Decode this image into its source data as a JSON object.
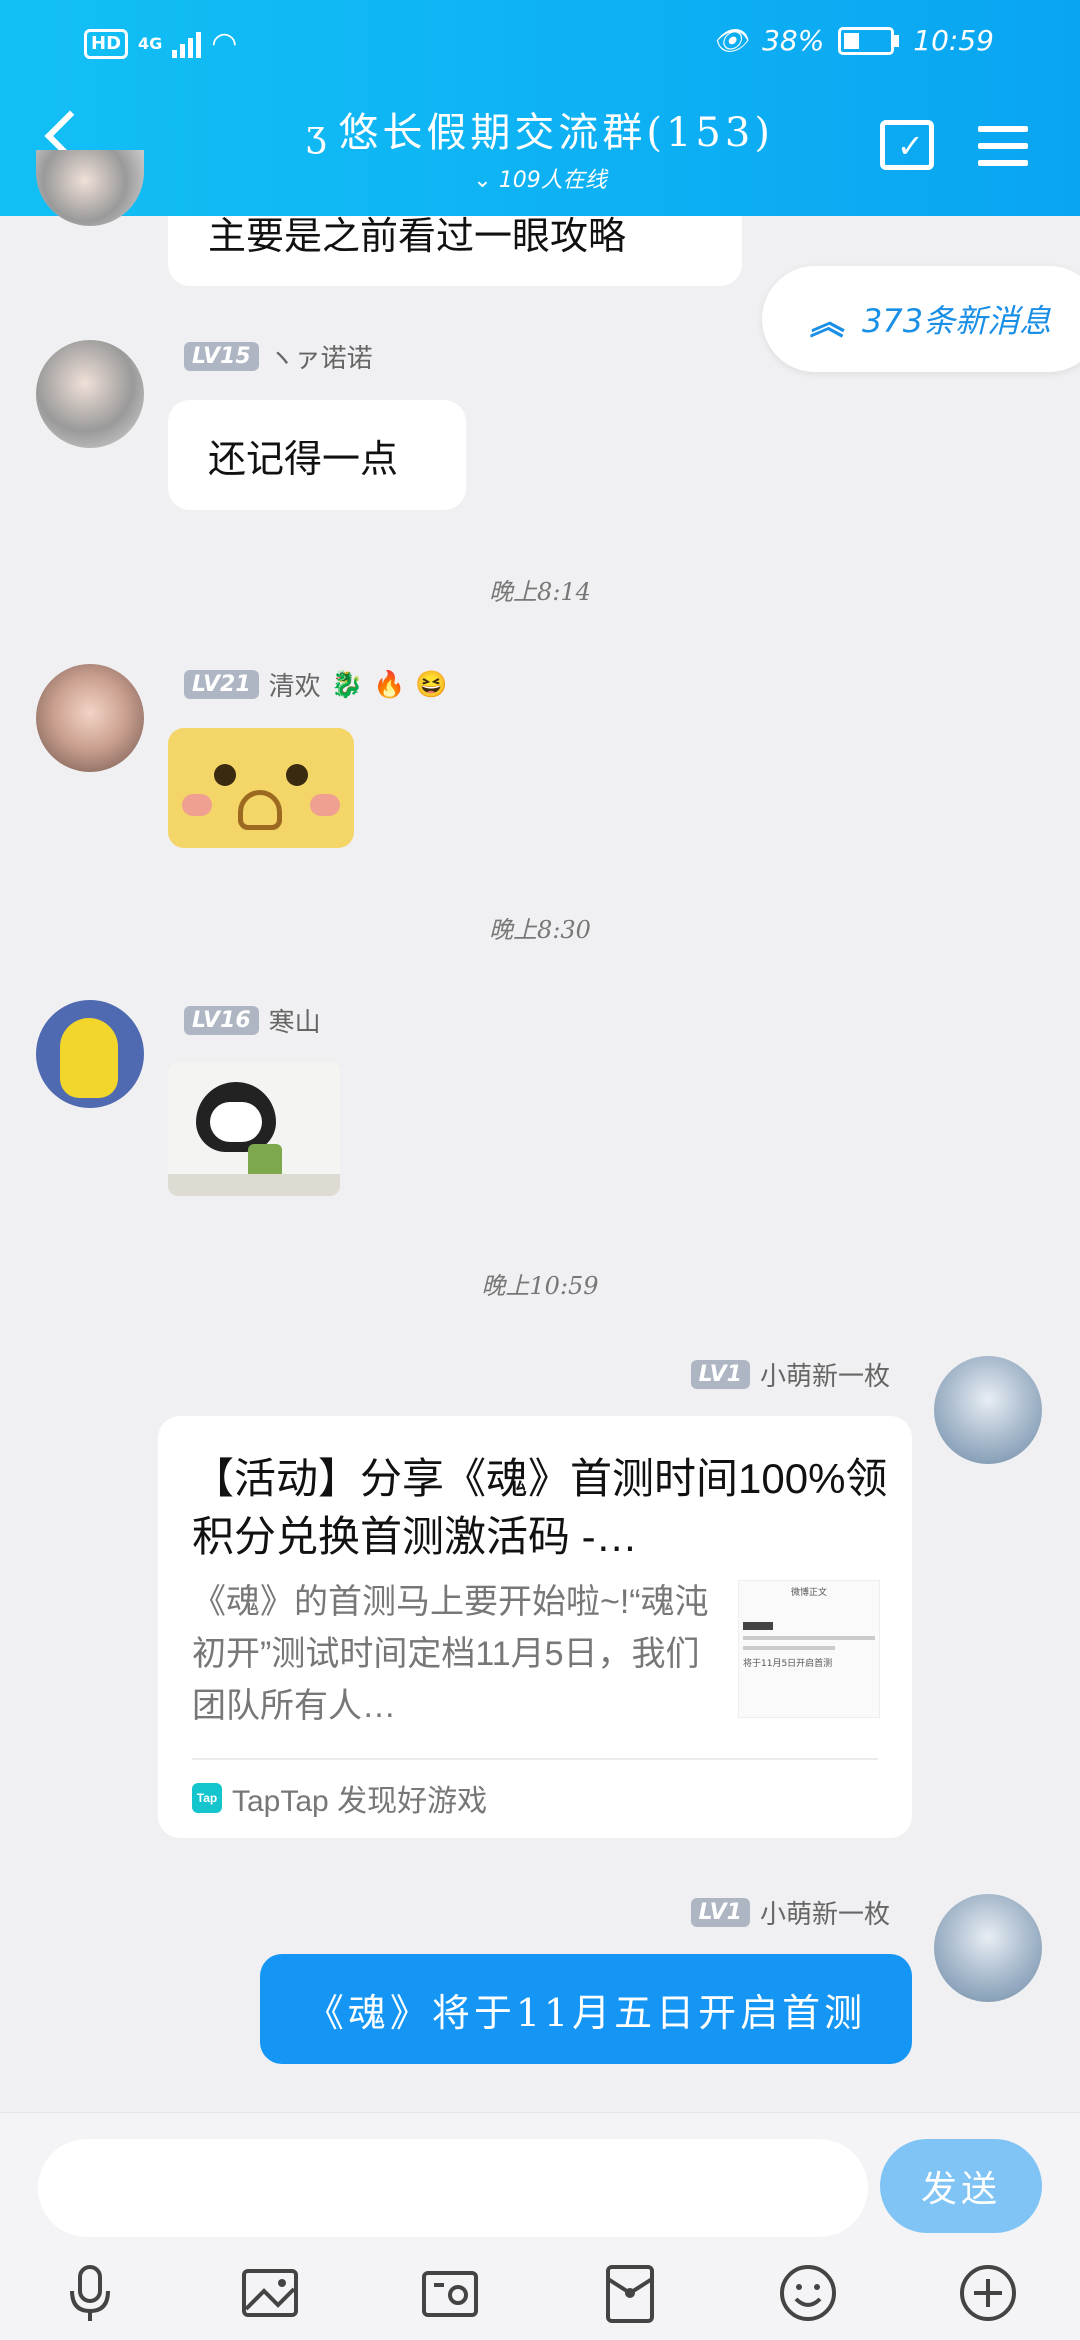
{
  "status_bar": {
    "hd": "HD",
    "network": "4G",
    "battery": "38%",
    "time": "10:59"
  },
  "header": {
    "title": "悠长假期交流群(153)",
    "online": "109人在线"
  },
  "new_messages": {
    "label": "373条新消息"
  },
  "messages": [
    {
      "type": "text",
      "text": "主要是之前看过一眼攻略"
    },
    {
      "type": "text",
      "level": "LV15",
      "sender": "ヽァ诺诺",
      "text": "还记得一点"
    },
    {
      "type": "time",
      "text": "晚上8:14"
    },
    {
      "type": "sticker",
      "level": "LV21",
      "sender": "清欢",
      "sender_emojis": [
        "dragon-emoji",
        "fire-emoji",
        "smiley-emoji"
      ]
    },
    {
      "type": "time",
      "text": "晚上8:30"
    },
    {
      "type": "sticker",
      "level": "LV16",
      "sender": "寒山"
    },
    {
      "type": "time",
      "text": "晚上10:59"
    },
    {
      "type": "card",
      "level": "LV1",
      "sender": "小萌新一枚",
      "card_title": "【活动】分享《魂》首测时间100%领积分兑换首测激活码 -…",
      "card_desc": "《魂》的首测马上要开始啦~!“魂沌初开”测试时间定档11月5日，我们团队所有人…",
      "card_source": "TapTap 发现好游戏",
      "thumb_title": "微博正文",
      "thumb_text": "将于11月5日开启首测"
    },
    {
      "type": "text",
      "level": "LV1",
      "sender": "小萌新一枚",
      "text": "《魂》将于11月五日开启首测"
    }
  ],
  "input": {
    "placeholder": "",
    "send": "发送"
  },
  "toolbar": [
    "microphone-icon",
    "picture-icon",
    "camera-icon",
    "red-packet-icon",
    "emoji-icon",
    "plus-icon"
  ]
}
